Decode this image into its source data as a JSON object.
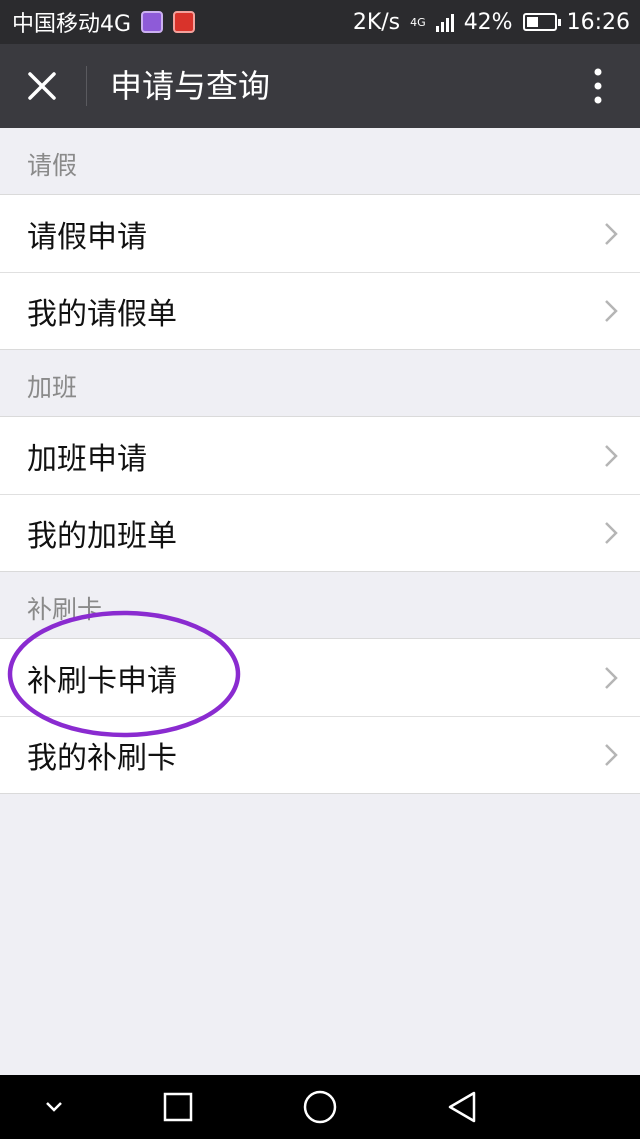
{
  "status_bar": {
    "carrier": "中国移动4G",
    "speed": "2K/s",
    "network_tag": "4G",
    "battery": "42%",
    "battery_level": 0.42,
    "time": "16:26"
  },
  "nav": {
    "title": "申请与查询",
    "close_icon": "close-icon",
    "more_icon": "more-vertical-icon"
  },
  "sections": [
    {
      "header": "请假",
      "items": [
        {
          "label": "请假申请"
        },
        {
          "label": "我的请假单"
        }
      ]
    },
    {
      "header": "加班",
      "items": [
        {
          "label": "加班申请"
        },
        {
          "label": "我的加班单"
        }
      ]
    },
    {
      "header": "补刷卡",
      "items": [
        {
          "label": "补刷卡申请"
        },
        {
          "label": "我的补刷卡"
        }
      ]
    }
  ],
  "annotation": {
    "color": "#8A2BD0",
    "target": "补刷卡申请"
  },
  "system_nav": {
    "buttons": [
      "chevron-down-icon",
      "recent-apps-icon",
      "home-icon",
      "back-icon"
    ]
  },
  "colors": {
    "nav_background": "#3A3A3F",
    "status_background": "#2B2B2E",
    "page_background": "#EFEFF4"
  }
}
